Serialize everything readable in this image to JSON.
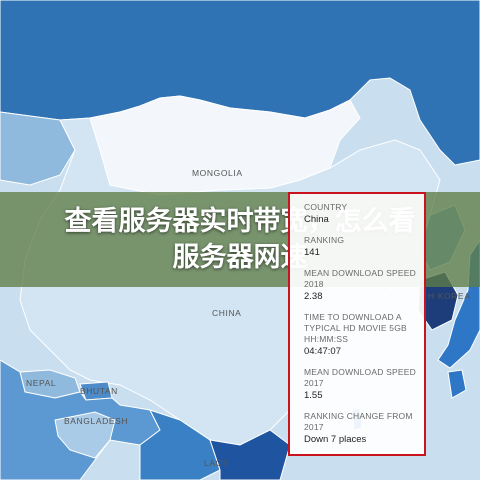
{
  "banner": {
    "line1": "查看服务器实时带宽，怎么看",
    "line2": "服务器网速"
  },
  "map": {
    "labels": {
      "mongolia": "MONGOLIA",
      "china": "CHINA",
      "nepal": "NEPAL",
      "bhutan": "BHUTAN",
      "bangladesh": "BANGLADESH",
      "laos": "LAOS",
      "south_korea": "H KOREA"
    },
    "colors": {
      "russia": "#2f73b5",
      "mongolia": "#f3f6fa",
      "china": "#d3e4f3",
      "korea": "#1d3d7a",
      "japan": "#2d77c6",
      "sea": "#c9dff0",
      "nepal": "#8fbade",
      "bhutan": "#4e8cc9",
      "india": "#5c99d2",
      "bangladesh": "#a9cbe8"
    }
  },
  "infobox": {
    "border_color": "#c9141d",
    "items": [
      {
        "label": "COUNTRY",
        "value": "China"
      },
      {
        "label": "RANKING",
        "value": "141"
      },
      {
        "label": "MEAN DOWNLOAD SPEED 2018",
        "value": "2.38"
      },
      {
        "label": "TIME TO DOWNLOAD A TYPICAL HD MOVIE 5GB HH:MM:SS",
        "value": "04:47:07"
      },
      {
        "label": "MEAN DOWNLOAD SPEED 2017",
        "value": "1.55"
      },
      {
        "label": "RANKING CHANGE FROM 2017",
        "value": "Down 7 places"
      }
    ]
  }
}
